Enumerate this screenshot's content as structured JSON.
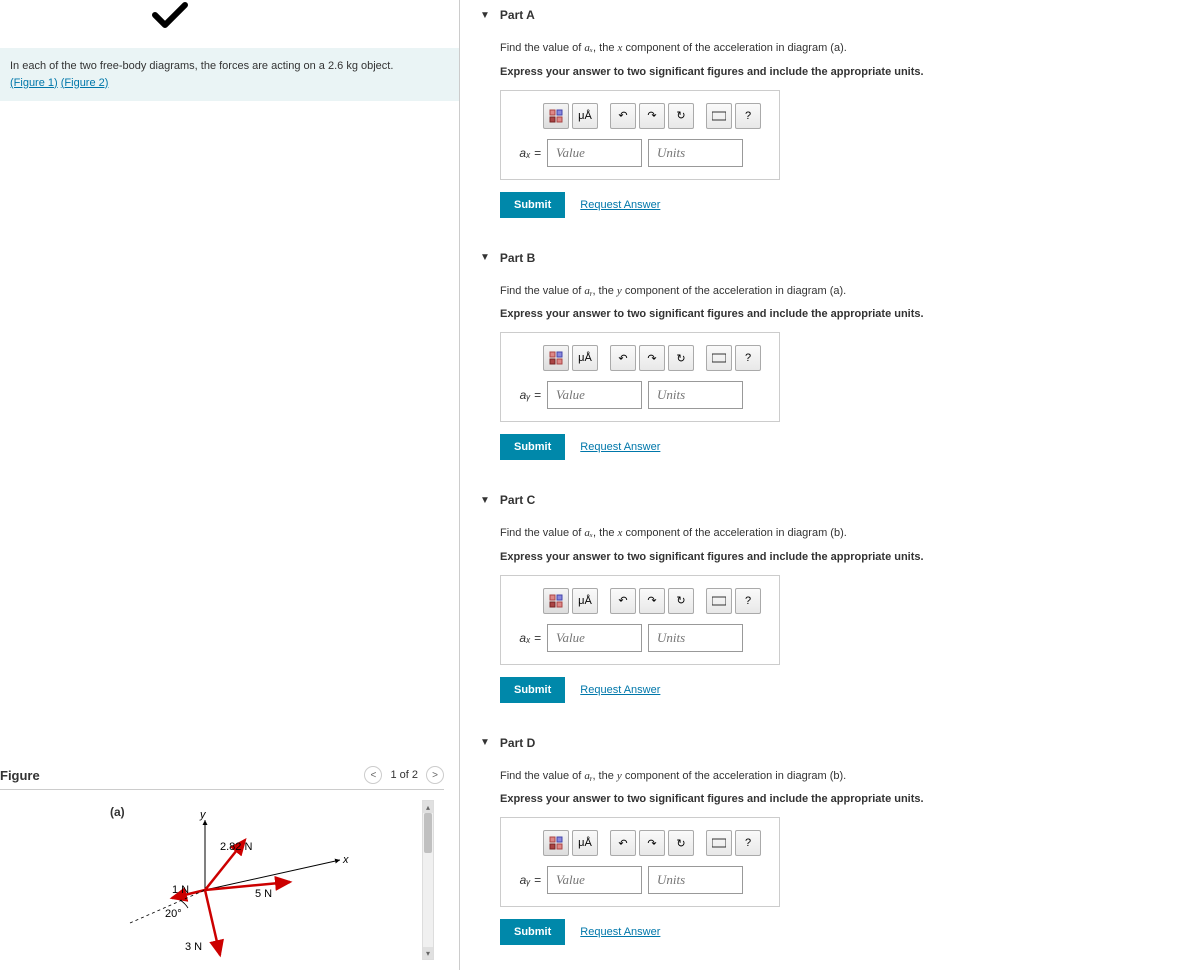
{
  "problem": {
    "text_before": "In each of the two free-body diagrams, the forces are acting on a 2.6 ",
    "mass_unit": "kg",
    "text_after": " object.",
    "figure1_link": "(Figure 1)",
    "figure2_link": "(Figure 2)"
  },
  "figure": {
    "title": "Figure",
    "nav_text": "1 of 2",
    "diagram_label": "(a)",
    "labels": {
      "y": "y",
      "x": "x",
      "f1": "2.82 N",
      "f2": "1 N",
      "f3": "5 N",
      "f4": "3 N",
      "angle": "20°"
    }
  },
  "parts": {
    "a": {
      "title": "Part A",
      "desc_pre": "Find the value of ",
      "var": "aₓ",
      "desc_mid": ", the ",
      "comp": "x",
      "desc_post": " component of the acceleration in diagram (a).",
      "instr": "Express your answer to two significant figures and include the appropriate units.",
      "label": "aₓ =",
      "value_placeholder": "Value",
      "units_placeholder": "Units"
    },
    "b": {
      "title": "Part B",
      "desc_pre": "Find the value of ",
      "var": "aᵧ",
      "desc_mid": ", the ",
      "comp": "y",
      "desc_post": " component of the acceleration in diagram (a).",
      "instr": "Express your answer to two significant figures and include the appropriate units.",
      "label": "aᵧ =",
      "value_placeholder": "Value",
      "units_placeholder": "Units"
    },
    "c": {
      "title": "Part C",
      "desc_pre": "Find the value of ",
      "var": "aₓ",
      "desc_mid": ", the ",
      "comp": "x",
      "desc_post": " component of the acceleration in diagram (b).",
      "instr": "Express your answer to two significant figures and include the appropriate units.",
      "label": "aₓ =",
      "value_placeholder": "Value",
      "units_placeholder": "Units"
    },
    "d": {
      "title": "Part D",
      "desc_pre": "Find the value of ",
      "var": "aᵧ",
      "desc_mid": ", the ",
      "comp": "y",
      "desc_post": " component of the acceleration in diagram (b).",
      "instr": "Express your answer to two significant figures and include the appropriate units.",
      "label": "aᵧ =",
      "value_placeholder": "Value",
      "units_placeholder": "Units"
    }
  },
  "buttons": {
    "submit": "Submit",
    "request": "Request Answer",
    "mua": "μÅ",
    "help": "?"
  }
}
